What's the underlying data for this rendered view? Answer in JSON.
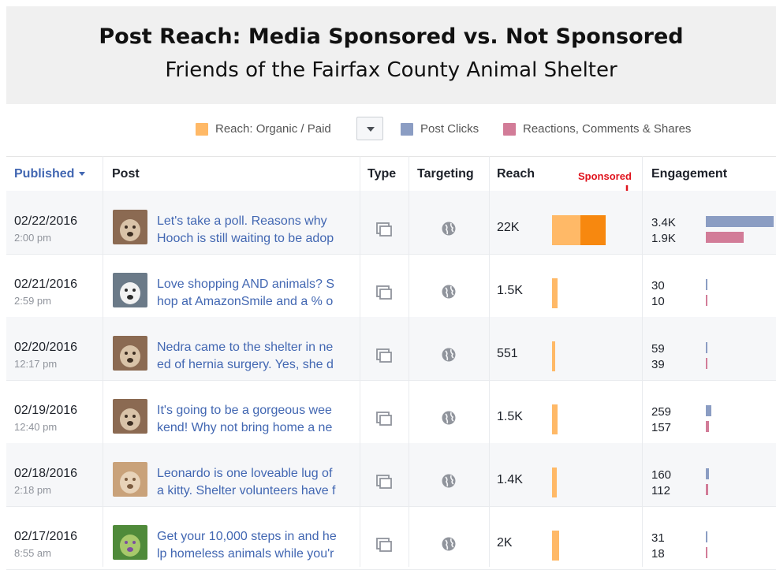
{
  "title": {
    "main": "Post Reach: Media Sponsored vs. Not Sponsored",
    "subtitle": "Friends of the Fairfax County Animal Shelter"
  },
  "legend": {
    "reach_label": "Reach: Organic / Paid",
    "clicks_label": "Post Clicks",
    "reactions_label": "Reactions, Comments & Shares",
    "colors": {
      "organic": "#ffb967",
      "paid": "#f7880f",
      "clicks": "#8b9dc3",
      "reactions": "#d27c98"
    }
  },
  "header": {
    "published": "Published",
    "post": "Post",
    "type": "Type",
    "targeting": "Targeting",
    "reach": "Reach",
    "engagement": "Engagement",
    "sponsored_annotation": "Sponsored"
  },
  "rows": [
    {
      "date": "02/22/2016",
      "time": "2:00 pm",
      "post_line1": "Let's take a poll. Reasons why",
      "post_line2": "Hooch is still waiting to be adop",
      "reach": "22K",
      "reach_organic": 15000,
      "reach_paid": 7000,
      "clicks": "3.4K",
      "reactions": "1.9K",
      "clicks_value": 3400,
      "reactions_value": 1900,
      "thumb_icon": "dog-photo-icon"
    },
    {
      "date": "02/21/2016",
      "time": "2:59 pm",
      "post_line1": "Love shopping AND animals? S",
      "post_line2": "hop at AmazonSmile and a % o",
      "reach": "1.5K",
      "reach_organic": 1500,
      "reach_paid": 0,
      "clicks": "30",
      "reactions": "10",
      "clicks_value": 30,
      "reactions_value": 10,
      "thumb_icon": "husky-photo-icon"
    },
    {
      "date": "02/20/2016",
      "time": "12:17 pm",
      "post_line1": "Nedra came to the shelter in ne",
      "post_line2": "ed of hernia surgery. Yes, she d",
      "reach": "551",
      "reach_organic": 551,
      "reach_paid": 0,
      "clicks": "59",
      "reactions": "39",
      "clicks_value": 59,
      "reactions_value": 39,
      "thumb_icon": "dog-photo-icon"
    },
    {
      "date": "02/19/2016",
      "time": "12:40 pm",
      "post_line1": "It's going to be a gorgeous wee",
      "post_line2": "kend! Why not bring home a ne",
      "reach": "1.5K",
      "reach_organic": 1500,
      "reach_paid": 0,
      "clicks": "259",
      "reactions": "157",
      "clicks_value": 259,
      "reactions_value": 157,
      "thumb_icon": "dog-photo-icon"
    },
    {
      "date": "02/18/2016",
      "time": "2:18 pm",
      "post_line1": "Leonardo is one loveable lug of",
      "post_line2": "a kitty. Shelter volunteers have f",
      "reach": "1.4K",
      "reach_organic": 1400,
      "reach_paid": 0,
      "clicks": "160",
      "reactions": "112",
      "clicks_value": 160,
      "reactions_value": 112,
      "thumb_icon": "cat-photo-icon"
    },
    {
      "date": "02/17/2016",
      "time": "8:55 am",
      "post_line1": "Get your 10,000 steps in and he",
      "post_line2": "lp homeless animals while you'r",
      "reach": "2K",
      "reach_organic": 2000,
      "reach_paid": 0,
      "clicks": "31",
      "reactions": "18",
      "clicks_value": 31,
      "reactions_value": 18,
      "thumb_icon": "walk-photo-icon"
    }
  ]
}
